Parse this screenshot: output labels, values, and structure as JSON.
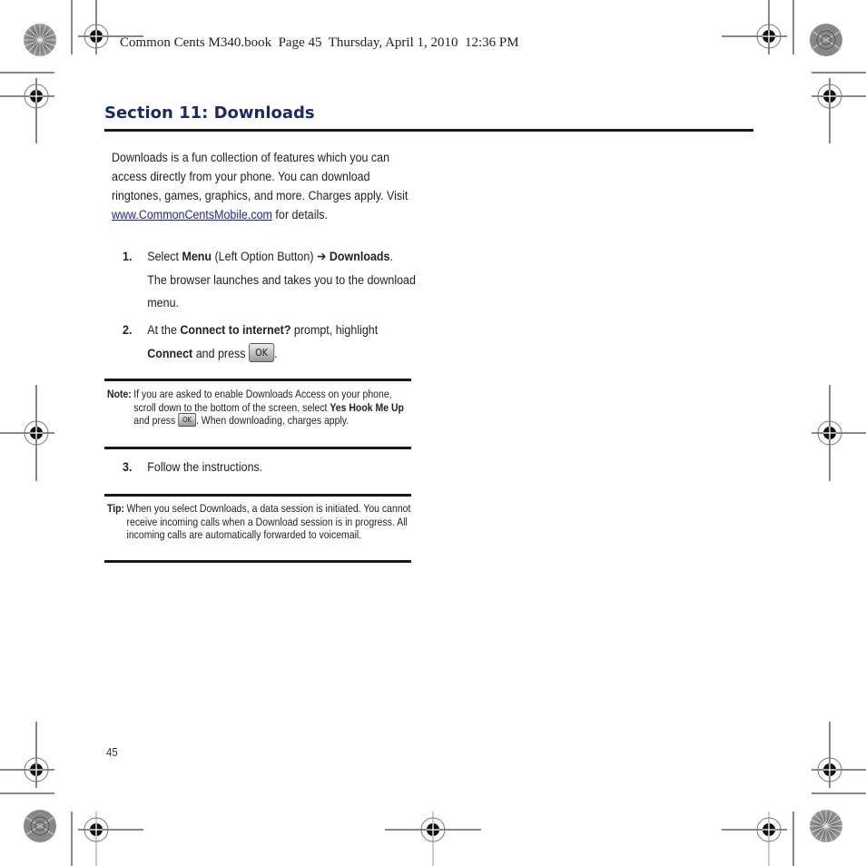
{
  "header": {
    "book_info": "Common Cents M340.book  Page 45  Thursday, April 1, 2010  12:36 PM"
  },
  "section": {
    "title": "Section 11: Downloads"
  },
  "intro": {
    "text_before_link": "Downloads is a fun collection of features which you can access directly from your phone. You can download ringtones, games, graphics, and more. Charges apply. Visit ",
    "link_text": "www.CommonCentsMobile.com",
    "text_after_link": " for details."
  },
  "steps": [
    {
      "number": "1.",
      "parts": [
        "Select ",
        "Menu",
        " (Left Option Button) ➔ ",
        "Downloads",
        "."
      ],
      "line2": "The browser launches and takes you to the download menu."
    },
    {
      "number": "2.",
      "parts": [
        "At the ",
        "Connect to internet?",
        " prompt, highlight ",
        "Connect",
        " and press "
      ],
      "key": "OK",
      "end": "."
    },
    {
      "number": "3.",
      "text": "Follow the instructions."
    }
  ],
  "note": {
    "label": "Note:",
    "text1": "If you are asked to enable Downloads Access on your phone, scroll down to the bottom of the screen, select ",
    "bold": "Yes Hook Me Up",
    "text2": " and press ",
    "key": "OK",
    "text3": ". When downloading, charges apply."
  },
  "tip": {
    "label": "Tip:",
    "text": "When you select Downloads, a data session is initiated. You cannot receive incoming calls when a Download session is in progress. All incoming calls are automatically forwarded to voicemail."
  },
  "footer": {
    "page_number": "45"
  },
  "colors": {
    "title": "#1e2a5c",
    "link": "#1e2a7c",
    "rule": "#1a1a1a"
  }
}
